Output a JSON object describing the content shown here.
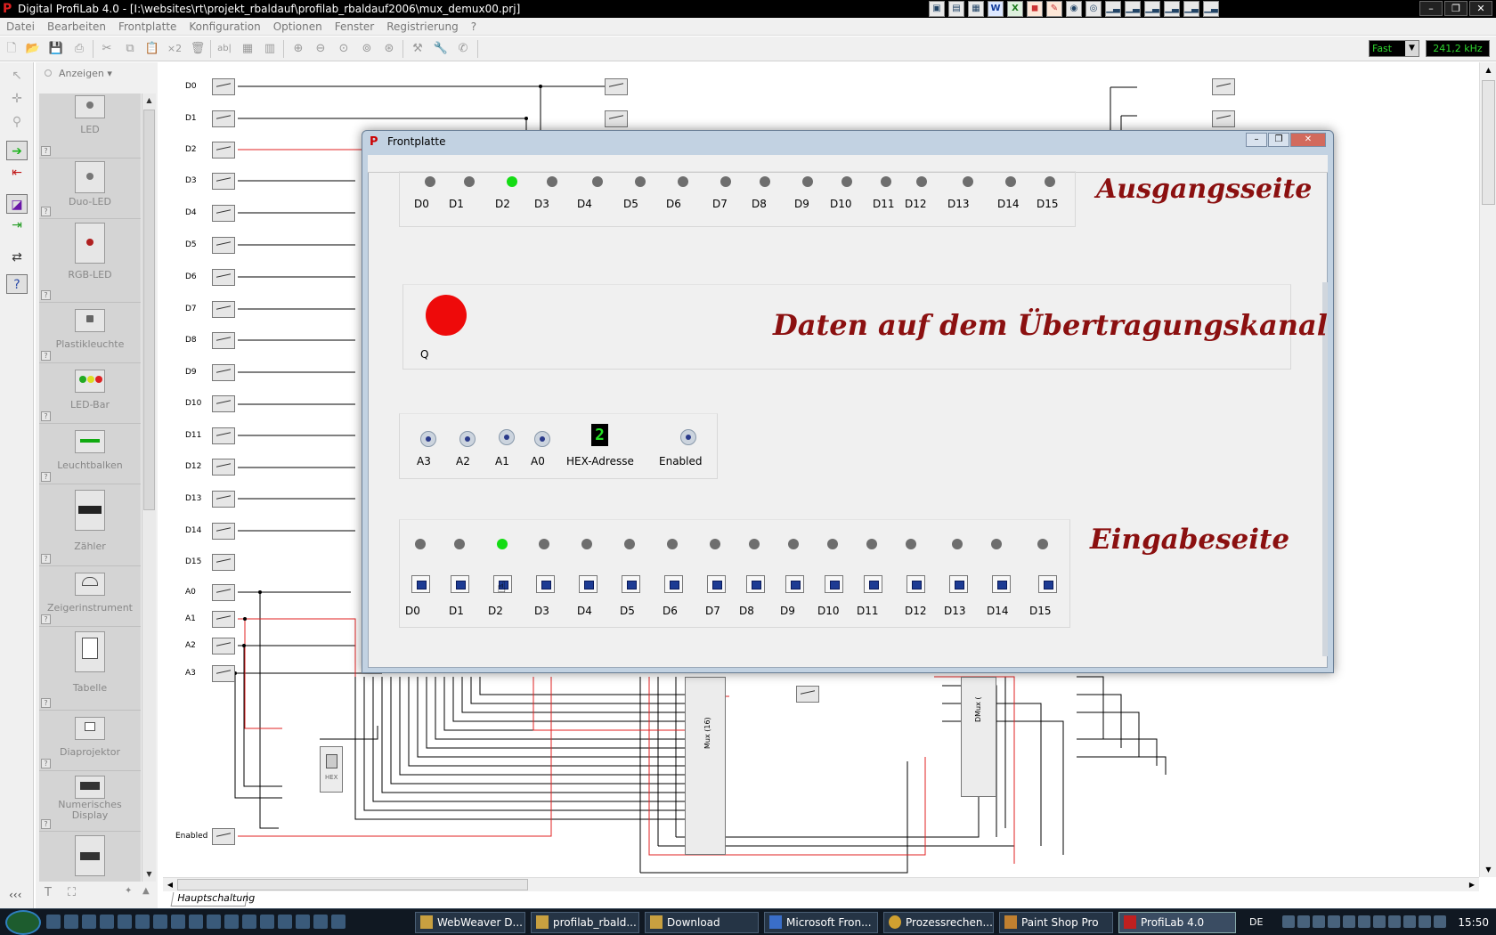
{
  "app": {
    "title": "Digital ProfiLab 4.0 - [I:\\websites\\rt\\projekt_rbaldauf\\profilab_rbaldauf2006\\mux_demux00.prj]",
    "icon": "profilab-logo-icon"
  },
  "menu": [
    "Datei",
    "Bearbeiten",
    "Frontplatte",
    "Konfiguration",
    "Optionen",
    "Fenster",
    "Registrierung",
    "?"
  ],
  "toolbar": {
    "speed_value": "Fast",
    "frequency": "241,2 kHz",
    "x2_label": "×2",
    "ab_label": "ab|"
  },
  "palette": {
    "view_label": "Anzeigen",
    "items": [
      {
        "label": "LED"
      },
      {
        "label": "Duo-LED"
      },
      {
        "label": "RGB-LED"
      },
      {
        "label": "Plastikleuchte"
      },
      {
        "label": "LED-Bar"
      },
      {
        "label": "Leuchtbalken"
      },
      {
        "label": "Zähler"
      },
      {
        "label": "Zeigerinstrument"
      },
      {
        "label": "Tabelle"
      },
      {
        "label": "Diaprojektor"
      },
      {
        "label": "Numerisches Display"
      },
      {
        "label": ""
      }
    ]
  },
  "schematic": {
    "inputs": [
      "D0",
      "D1",
      "D2",
      "D3",
      "D4",
      "D5",
      "D6",
      "D7",
      "D8",
      "D9",
      "D10",
      "D11",
      "D12",
      "D13",
      "D14",
      "D15"
    ],
    "address_inputs": [
      "A0",
      "A1",
      "A2",
      "A3"
    ],
    "enabled_label": "Enabled",
    "mux_title": "Mux (16)",
    "dmux_title": "DMux (",
    "hex_label": "HEX"
  },
  "sheet_tab": "Hauptschaltung",
  "frontplatte": {
    "title": "Frontplatte",
    "output_title": "Ausgangsseite",
    "channel_title": "Daten auf dem Übertragungskanal",
    "input_title": "Eingabeseite",
    "q_label": "Q",
    "q_state": "on",
    "hex_label": "HEX-Adresse",
    "hex_value": "2",
    "enabled_label": "Enabled",
    "address_switches": [
      "A3",
      "A2",
      "A1",
      "A0"
    ],
    "outputs": [
      "D0",
      "D1",
      "D2",
      "D3",
      "D4",
      "D5",
      "D6",
      "D7",
      "D8",
      "D9",
      "D10",
      "D11",
      "D12",
      "D13",
      "D14",
      "D15"
    ],
    "active_output_index": 2,
    "active_input_index": 2,
    "inputs": [
      "D0",
      "D1",
      "D2",
      "D3",
      "D4",
      "D5",
      "D6",
      "D7",
      "D8",
      "D9",
      "D10",
      "D11",
      "D12",
      "D13",
      "D14",
      "D15"
    ]
  },
  "taskbar": {
    "tasks": [
      "WebWeaver D...",
      "profilab_rbald...",
      "Download",
      "Microsoft Fron...",
      "Prozessrechen...",
      "Paint Shop Pro",
      "ProfiLab 4.0"
    ],
    "language": "DE",
    "clock": "15:50"
  },
  "colors": {
    "title_red": "#8b1010",
    "led_on": "#14dc14",
    "led_off": "#6e6e6e",
    "q_led": "#ee0a0a",
    "wire_red": "#e02020",
    "digital_green": "#2ed62e"
  }
}
